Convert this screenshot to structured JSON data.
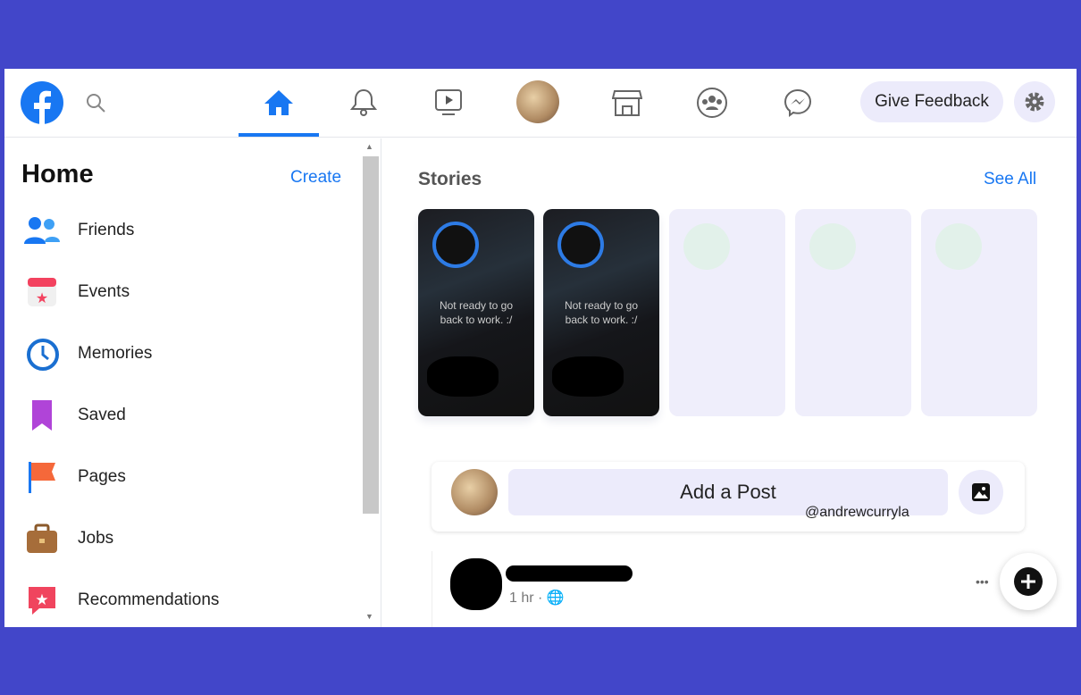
{
  "topbar": {
    "feedback_label": "Give Feedback",
    "nav": [
      "home-icon",
      "bell-icon",
      "video-icon",
      "profile-avatar",
      "marketplace-icon",
      "groups-icon",
      "messenger-icon"
    ],
    "accent": "#1877f2"
  },
  "sidebar": {
    "title": "Home",
    "create_label": "Create",
    "items": [
      {
        "label": "Friends",
        "icon": "friends-icon"
      },
      {
        "label": "Events",
        "icon": "events-icon"
      },
      {
        "label": "Memories",
        "icon": "memories-icon"
      },
      {
        "label": "Saved",
        "icon": "saved-icon"
      },
      {
        "label": "Pages",
        "icon": "pages-icon"
      },
      {
        "label": "Jobs",
        "icon": "jobs-icon"
      },
      {
        "label": "Recommendations",
        "icon": "recommendations-icon"
      }
    ]
  },
  "stories": {
    "title": "Stories",
    "see_all": "See All",
    "cards": [
      {
        "text": "Not ready to go back to work. :/"
      },
      {
        "text": "Not ready to go back to work. :/"
      }
    ]
  },
  "composer": {
    "add_post": "Add a Post",
    "watermark": "@andrewcurryla"
  },
  "post": {
    "time": "1 hr ·",
    "more": "•••"
  }
}
